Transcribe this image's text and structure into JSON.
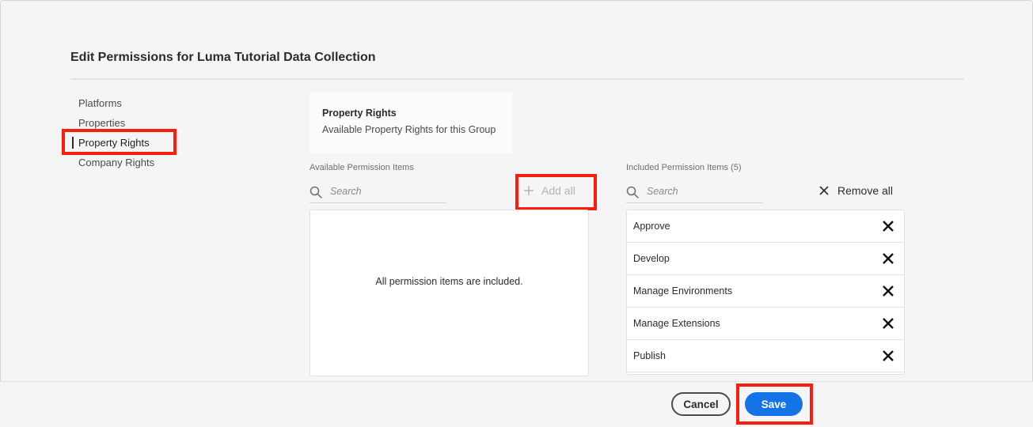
{
  "dialog": {
    "title": "Edit Permissions for Luma Tutorial Data Collection"
  },
  "sidebar": {
    "items": [
      {
        "label": "Platforms",
        "selected": false
      },
      {
        "label": "Properties",
        "selected": false
      },
      {
        "label": "Property Rights",
        "selected": true
      },
      {
        "label": "Company Rights",
        "selected": false
      }
    ]
  },
  "group_card": {
    "title": "Property Rights",
    "subtitle": "Available Property Rights for this Group"
  },
  "available": {
    "label": "Available Permission Items",
    "search_placeholder": "Search",
    "add_all_label": "Add all",
    "empty_message": "All permission items are included."
  },
  "included": {
    "label": "Included Permission Items (5)",
    "search_placeholder": "Search",
    "remove_all_label": "Remove all",
    "items": [
      "Approve",
      "Develop",
      "Manage Environments",
      "Manage Extensions",
      "Publish"
    ]
  },
  "footer": {
    "cancel_label": "Cancel",
    "save_label": "Save"
  },
  "colors": {
    "accent": "#1473e6",
    "highlight": "#fa1e0f"
  },
  "icons": [
    "search-icon",
    "plus-icon",
    "close-icon"
  ]
}
